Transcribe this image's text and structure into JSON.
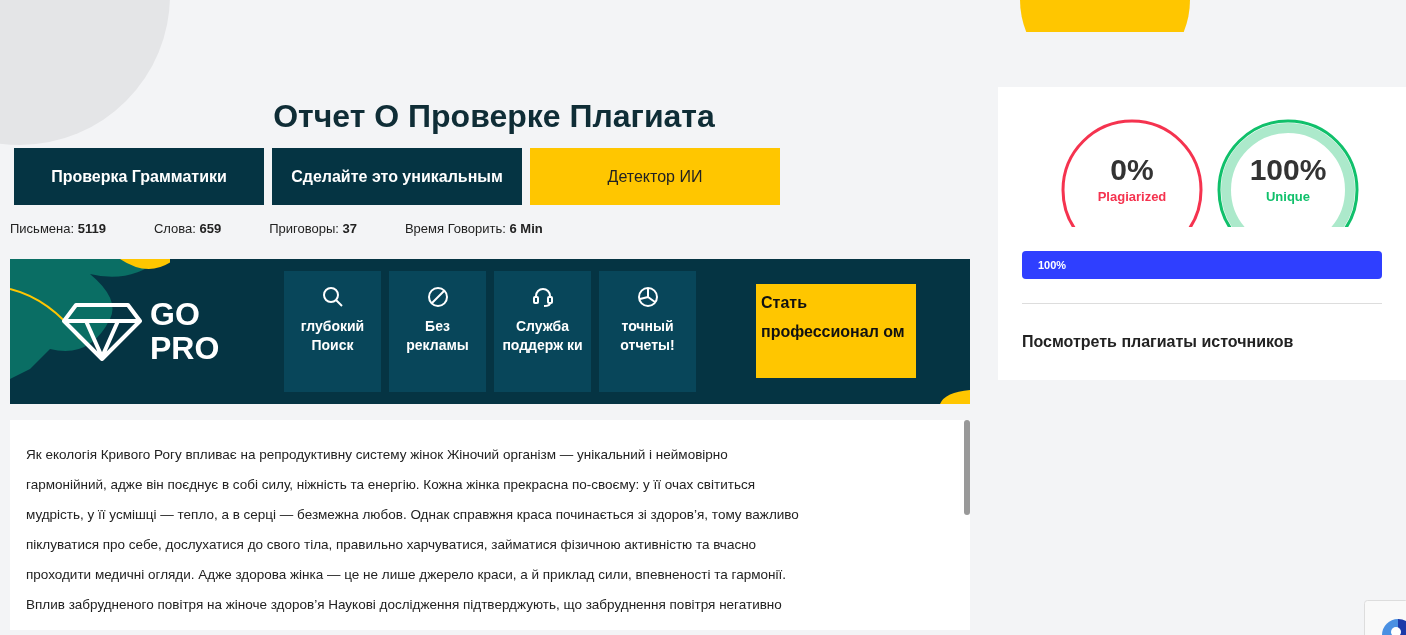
{
  "title": "Отчет О Проверке Плагиата",
  "buttons": [
    {
      "label": "Проверка Грамматики",
      "kind": "dark"
    },
    {
      "label": "Сделайте это уникальным",
      "kind": "dark"
    },
    {
      "label": "Детектор ИИ",
      "kind": "yellow"
    }
  ],
  "stats": [
    "Письмена: **5119**",
    "Слова: **659**",
    "Приговоры: **37**",
    "Время Говорить: **6 Min**"
  ],
  "promo": {
    "logo_text": [
      "GO",
      "PRO"
    ],
    "features": [
      {
        "kind": "search",
        "label": "глубокий Поиск"
      },
      {
        "kind": "noads",
        "label": "Без рекламы"
      },
      {
        "kind": "support",
        "label": "Служба поддерж ки"
      },
      {
        "kind": "chart",
        "label": "точный отчеты!"
      }
    ],
    "cta": "Стать профессионал ом"
  },
  "text_lines": [
    "Як екологія Кривого Рогу впливає на репродуктивну систему жінок Жіночий організм — унікальний і неймовірно",
    "гармонійний, адже він поєднує в собі силу, ніжність та енергію. Кожна жінка прекрасна по-своєму: у її очах світиться",
    "мудрість, у її усмішці — тепло, а в серці — безмежна любов. Однак справжня краса починається зі здоров’я, тому важливо",
    "піклуватися про себе, дослухатися до свого тіла, правильно харчуватися, займатися фізичною активністю та вчасно",
    "проходити медичні огляди. Адже здорова жінка — це не лише джерело краси, а й приклад сили, впевненості та гармонії.",
    "Вплив забрудненого повітря на жіноче здоров’я Наукові дослідження підтверджують, що забруднення повітря негативно"
  ],
  "gauges": [
    {
      "value": "0%",
      "label": "Plagiarized",
      "color": "#f5334f"
    },
    {
      "value": "100%",
      "label": "Unique",
      "color": "#10c06b"
    }
  ],
  "progress": {
    "level": 1,
    "label": "100%"
  },
  "sources_link": "Посмотреть плагиаты источников"
}
